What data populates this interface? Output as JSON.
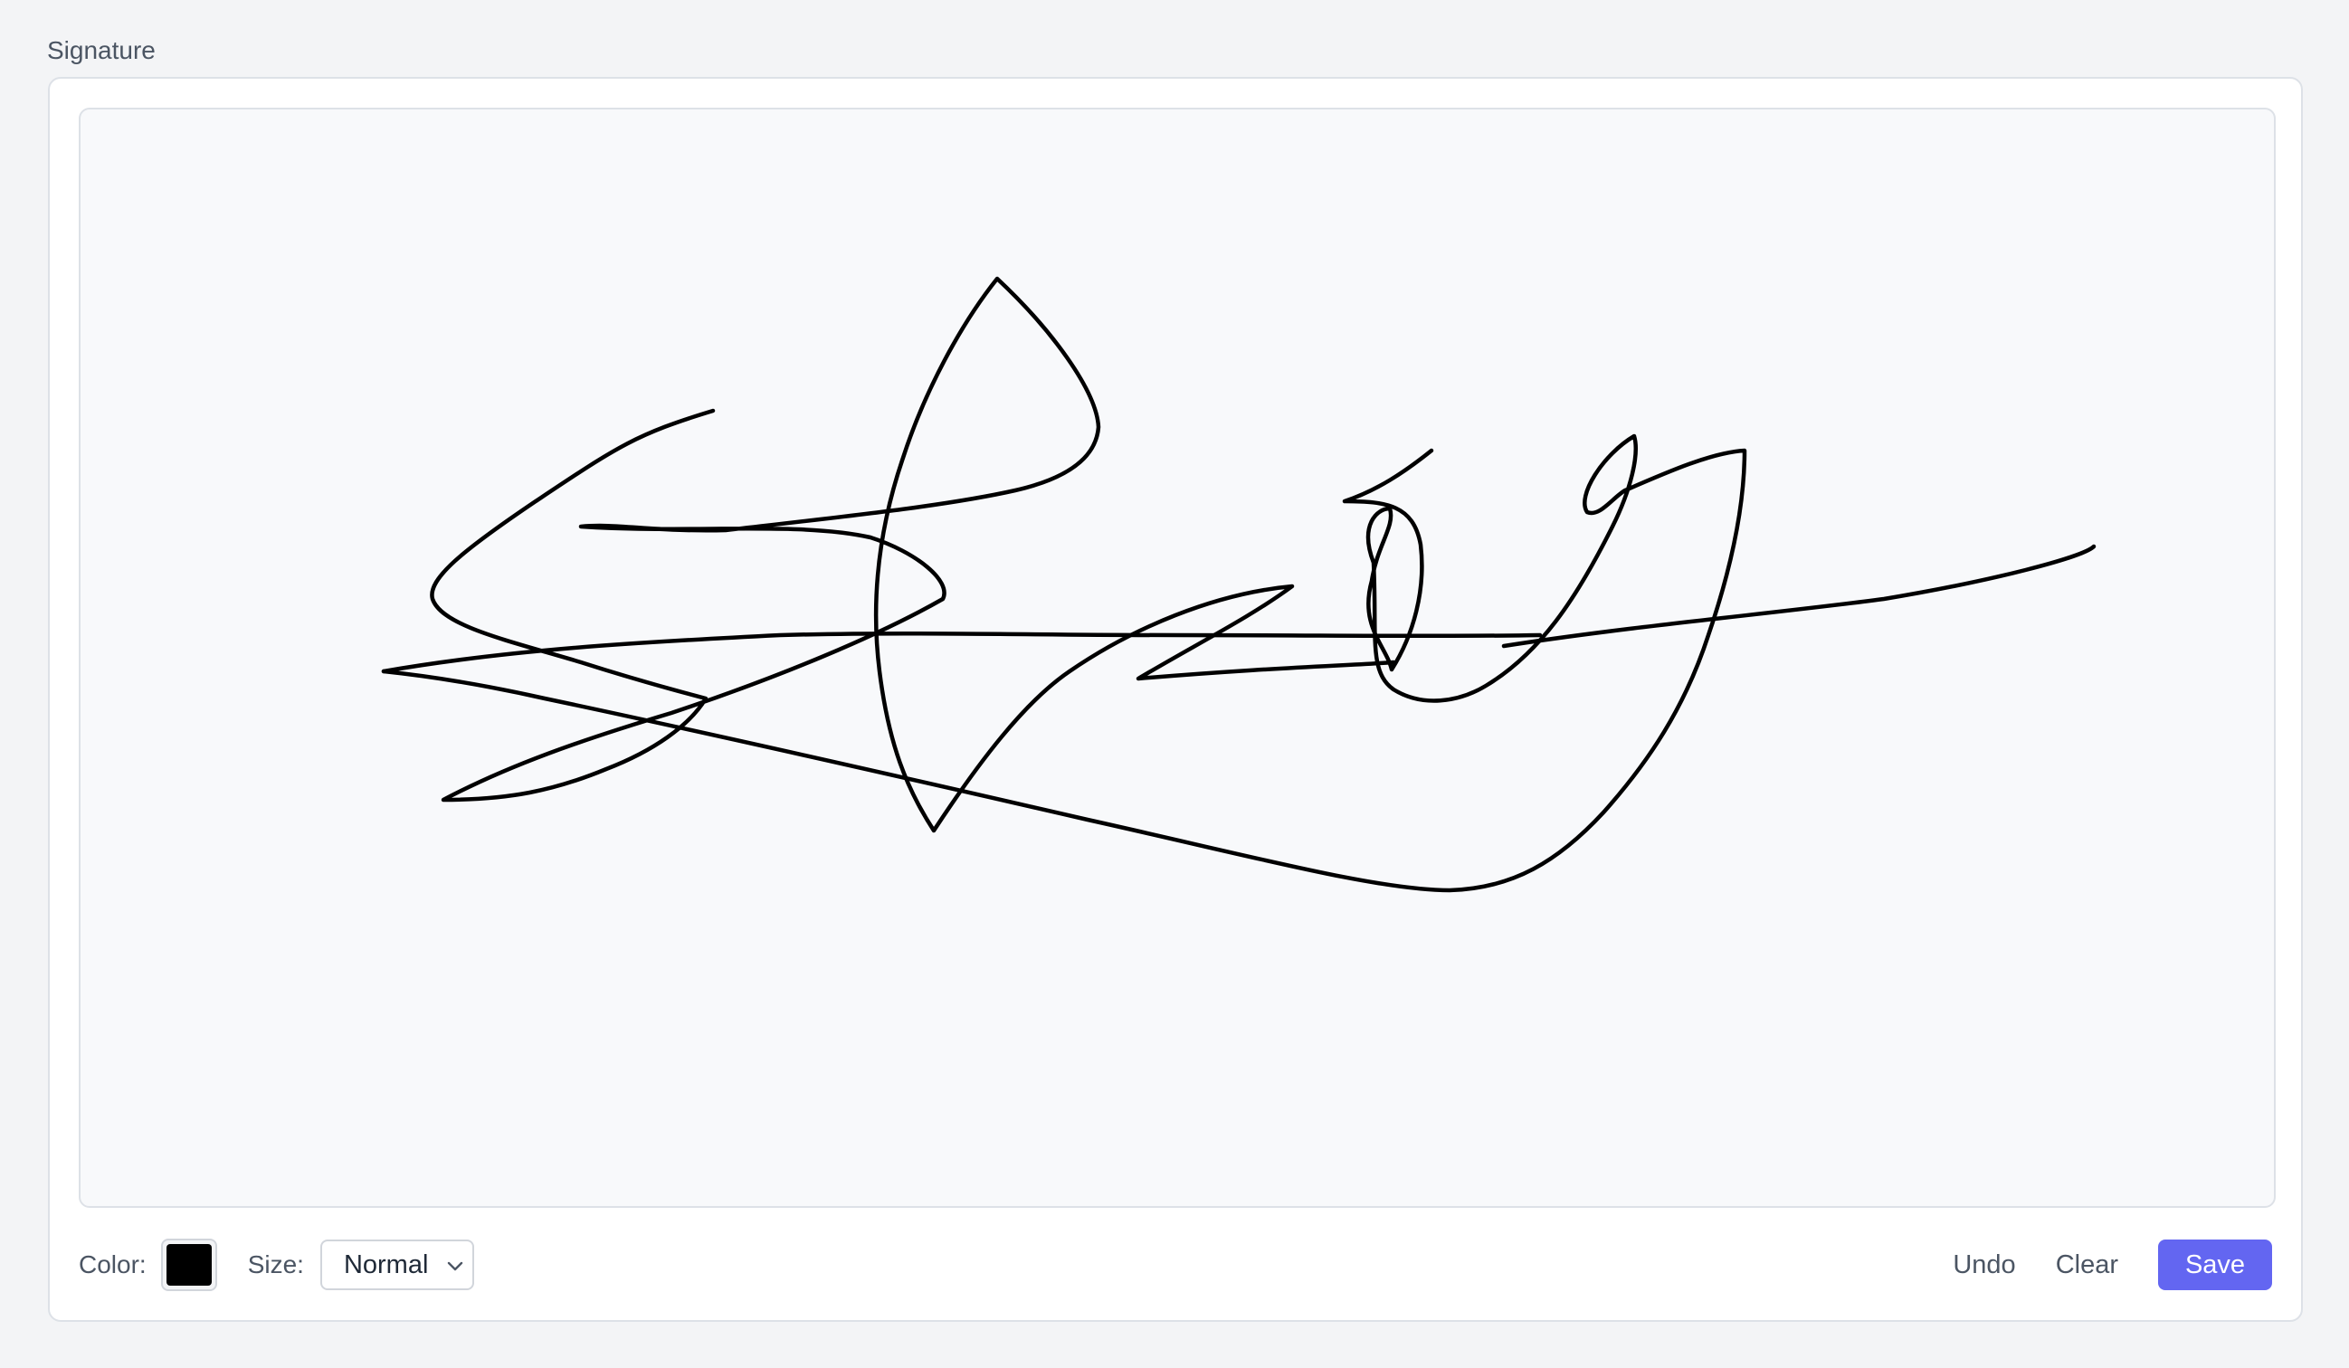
{
  "field": {
    "label": "Signature"
  },
  "toolbar": {
    "color_label": "Color:",
    "pen_color": "#000000",
    "size_label": "Size:",
    "size_value": "Normal",
    "size_icon": "chevron-down-icon",
    "undo_label": "Undo",
    "clear_label": "Clear",
    "save_label": "Save",
    "save_color": "#6366f1"
  },
  "pad": {
    "background": "#f8f9fb",
    "has_signature": true
  }
}
